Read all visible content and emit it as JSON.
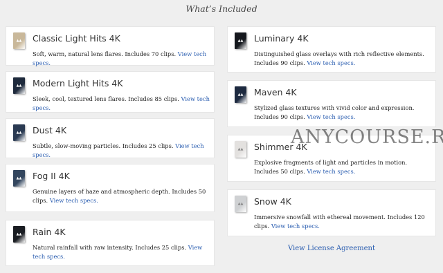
{
  "heading": "What’s Included",
  "colors": {
    "link": "#2a5db0",
    "card_bg": "#ffffff",
    "page_bg": "#efefef"
  },
  "left": [
    {
      "title": "Classic Light Hits 4K",
      "desc": "Soft, warm, natural lens flares. Includes 70 clips.",
      "link": "View tech specs.",
      "box_color": "#c9b89a"
    },
    {
      "title": "Modern Light Hits 4K",
      "desc": "Sleek, cool, textured lens flares. Includes 85 clips.",
      "link": "View tech specs.",
      "box_color": "#1e2a3c"
    },
    {
      "title": "Dust 4K",
      "desc": "Subtle, slow-moving particles. Includes 25 clips.",
      "link": "View tech specs.",
      "box_color": "#2a3a52"
    },
    {
      "title": "Fog II 4K",
      "desc": "Genuine layers of haze and atmospheric depth. Includes 50 clips.",
      "link": "View tech specs.",
      "box_color": "#33465e"
    },
    {
      "title": "Rain 4K",
      "desc": "Natural rainfall with raw intensity. Includes 25 clips.",
      "link": "View tech specs.",
      "box_color": "#1a1d22"
    }
  ],
  "right": [
    {
      "title": "Luminary 4K",
      "desc": "Distinguished glass overlays with rich reflective elements. Includes 90 clips.",
      "link": "View tech specs.",
      "box_color": "#15181d"
    },
    {
      "title": "Maven 4K",
      "desc": "Stylized glass textures with vivid color and expression. Includes 90 clips.",
      "link": "View tech specs.",
      "box_color": "#1d2a40"
    },
    {
      "title": "Shimmer 4K",
      "desc": "Explosive fragments of light and particles in motion. Includes 50 clips.",
      "link": "View tech specs.",
      "box_color": "#e3e1df"
    },
    {
      "title": "Snow 4K",
      "desc": "Immersive snowfall with ethereal movement. Includes 120 clips.",
      "link": "View tech specs.",
      "box_color": "#cfd1d3"
    }
  ],
  "license_link": "View License Agreement",
  "watermark": "ANYCOURSE.RU"
}
